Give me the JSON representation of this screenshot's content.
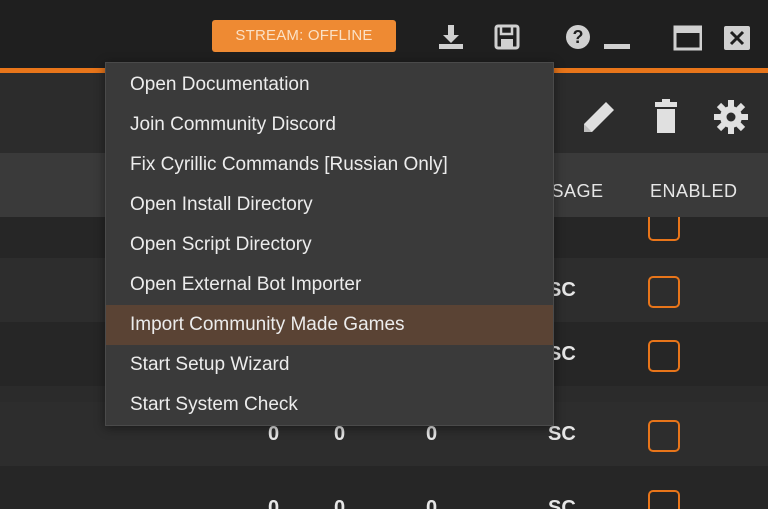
{
  "titlebar": {
    "stream_status": "STREAM: OFFLINE",
    "icons": [
      "download-icon",
      "save-icon",
      "help-icon",
      "minimize-icon",
      "maximize-icon",
      "close-icon"
    ]
  },
  "toolbar": {
    "icons": [
      "pencil-icon",
      "trash-icon",
      "gear-icon"
    ]
  },
  "table": {
    "headers": {
      "usage": "USAGE",
      "enabled": "ENABLED"
    },
    "rows": [
      {
        "c1": "",
        "c2": "",
        "c3": "",
        "usage": "SC",
        "enabled": false
      },
      {
        "c1": "",
        "c2": "",
        "c3": "",
        "usage": "SC",
        "enabled": false
      },
      {
        "c1": "",
        "c2": "",
        "c3": "",
        "usage": "SC",
        "enabled": false
      },
      {
        "c1": "0",
        "c2": "0",
        "c3": "0",
        "usage": "SC",
        "enabled": false
      },
      {
        "c1": "0",
        "c2": "0",
        "c3": "0",
        "usage": "SC",
        "enabled": false
      }
    ]
  },
  "menu": {
    "items": [
      "Open Documentation",
      "Join Community Discord",
      "Fix Cyrillic Commands [Russian Only]",
      "Open Install Directory",
      "Open Script Directory",
      "Open External Bot Importer",
      "Import Community Made Games",
      "Start Setup Wizard",
      "Start System Check"
    ],
    "highlighted_index": 6
  },
  "colors": {
    "accent": "#e8751a",
    "badge": "#ee8a33",
    "menu_bg": "#3a3a3a",
    "menu_highlight": "#5a4334"
  }
}
